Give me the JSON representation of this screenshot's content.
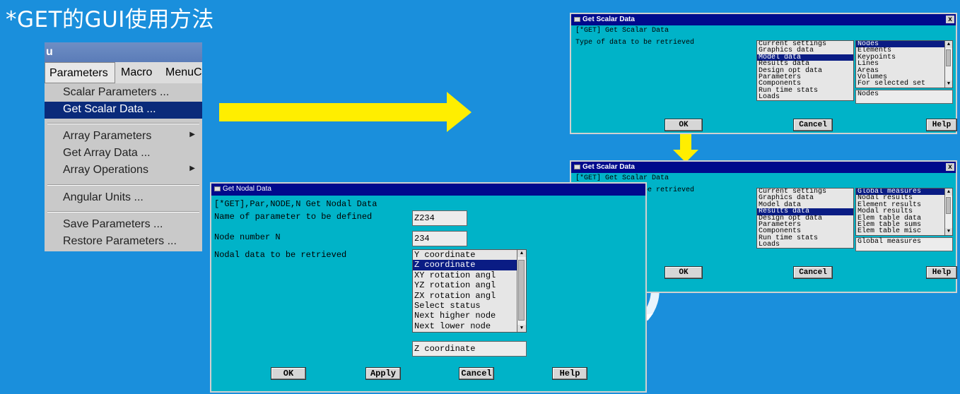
{
  "slide": {
    "title": "*GET的GUI使用方法"
  },
  "menu": {
    "window_label": "u",
    "bar": [
      "Parameters",
      "Macro",
      "MenuC"
    ],
    "items": [
      {
        "label": "Scalar Parameters ...",
        "submenu": false
      },
      {
        "label": "Get Scalar Data ...",
        "submenu": false,
        "selected": true
      },
      {
        "label": "Array Parameters",
        "submenu": true
      },
      {
        "label": "Get Array Data ...",
        "submenu": false
      },
      {
        "label": "Array Operations",
        "submenu": true
      },
      {
        "label": "Angular Units ...",
        "submenu": false
      },
      {
        "label": "Save Parameters ...",
        "submenu": false
      },
      {
        "label": "Restore Parameters ...",
        "submenu": false
      }
    ]
  },
  "scalar1": {
    "title": "Get Scalar Data",
    "close": "x",
    "header": "[*GET]  Get Scalar Data",
    "prompt": "Type of data to be retrieved",
    "left_list": [
      "Current settings",
      "Graphics data",
      "Model data",
      "Results data",
      "Design opt data",
      "Parameters",
      "Components",
      "Run time stats",
      "Loads"
    ],
    "left_selected": 2,
    "right_list": [
      "Nodes",
      "Elements",
      "Keypoints",
      "Lines",
      "Areas",
      "Volumes",
      "For selected set"
    ],
    "right_selected": 0,
    "field_value": "Nodes",
    "ok": "OK",
    "cancel": "Cancel",
    "help": "Help"
  },
  "scalar2": {
    "title": "Get Scalar Data",
    "close": "x",
    "header": "[*GET]  Get Scalar Data",
    "prompt": "Type of data to be retrieved",
    "left_list": [
      "Current settings",
      "Graphics data",
      "Model data",
      "Results data",
      "Design opt data",
      "Parameters",
      "Components",
      "Run time stats",
      "Loads"
    ],
    "left_selected": 3,
    "right_list": [
      "Global measures",
      "Nodal results",
      "Element results",
      "Modal results",
      "Elem table data",
      "Elem table sums",
      "Elem table misc"
    ],
    "right_selected": 0,
    "field_value": "Global measures",
    "ok": "OK",
    "cancel": "Cancel",
    "help": "Help"
  },
  "nodal": {
    "title": "Get Nodal Data",
    "header": "[*GET],Par,NODE,N   Get Nodal Data",
    "param_label": "Name of parameter to be defined",
    "param_value": "Z234",
    "node_label": "Node number N",
    "node_value": "234",
    "data_label": "Nodal data to be retrieved",
    "list": [
      "Y coordinate",
      "Z coordinate",
      "XY rotation angl",
      "YZ rotation angl",
      "ZX rotation angl",
      "Select status",
      "Next higher node",
      "Next lower node"
    ],
    "selected": 1,
    "field_value": "Z coordinate",
    "ok": "OK",
    "apply": "Apply",
    "cancel": "Cancel",
    "help": "Help"
  },
  "colors": {
    "background": "#1a8fdc",
    "dialog": "#00b3c8",
    "titlebar": "#000a8c",
    "arrow": "#ffee00"
  }
}
